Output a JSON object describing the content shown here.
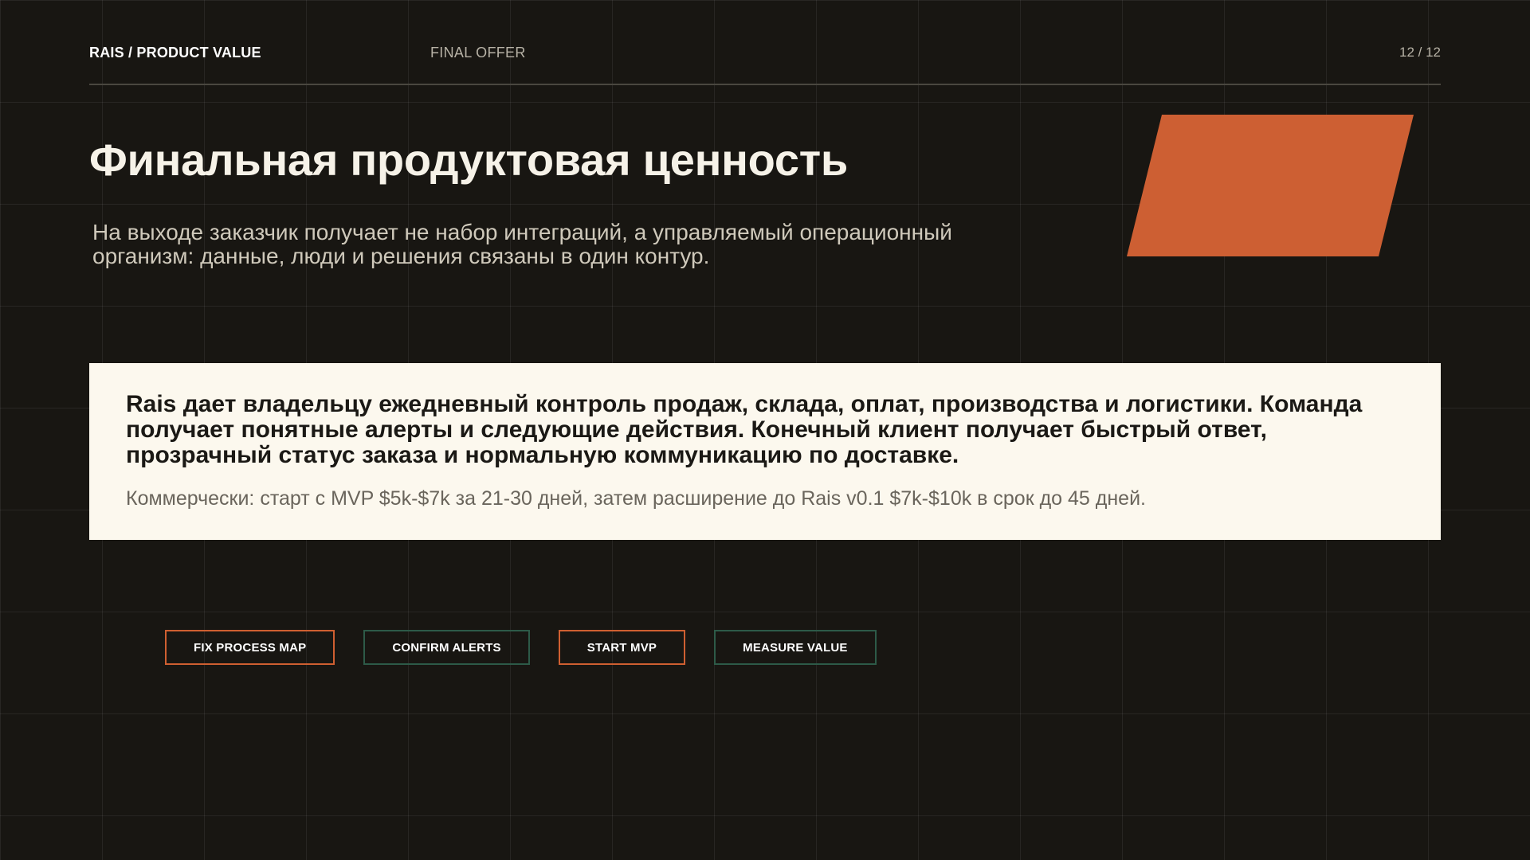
{
  "header": {
    "brand": "RAIS / PRODUCT VALUE",
    "section": "FINAL OFFER",
    "page_counter": "12 / 12"
  },
  "title": "Финальная продуктовая ценность",
  "subtitle": "На выходе заказчик получает не набор интеграций, а управляемый операционный организм: данные, люди и решения связаны в один контур.",
  "card": {
    "lead": "Rais дает владельцу ежедневный контроль продаж, склада, оплат, производства и логистики. Команда получает понятные алерты и следующие действия. Конечный клиент получает быстрый ответ, прозрачный статус заказа и нормальную коммуникацию по доставке.",
    "note": "Коммерчески: старт с MVP $5k-$7k за 21-30 дней, затем расширение до Rais v0.1 $7k-$10k в срок до 45 дней."
  },
  "actions": [
    {
      "label": "FIX PROCESS MAP",
      "color": "#cf5f31"
    },
    {
      "label": "CONFIRM ALERTS",
      "color": "#2d5a48"
    },
    {
      "label": "START MVP",
      "color": "#cf5f31"
    },
    {
      "label": "MEASURE VALUE",
      "color": "#2d5a48"
    }
  ],
  "colors": {
    "background": "#181612",
    "accent": "#cd5f33",
    "card": "#fcf8ee",
    "green": "#2d5a48"
  }
}
